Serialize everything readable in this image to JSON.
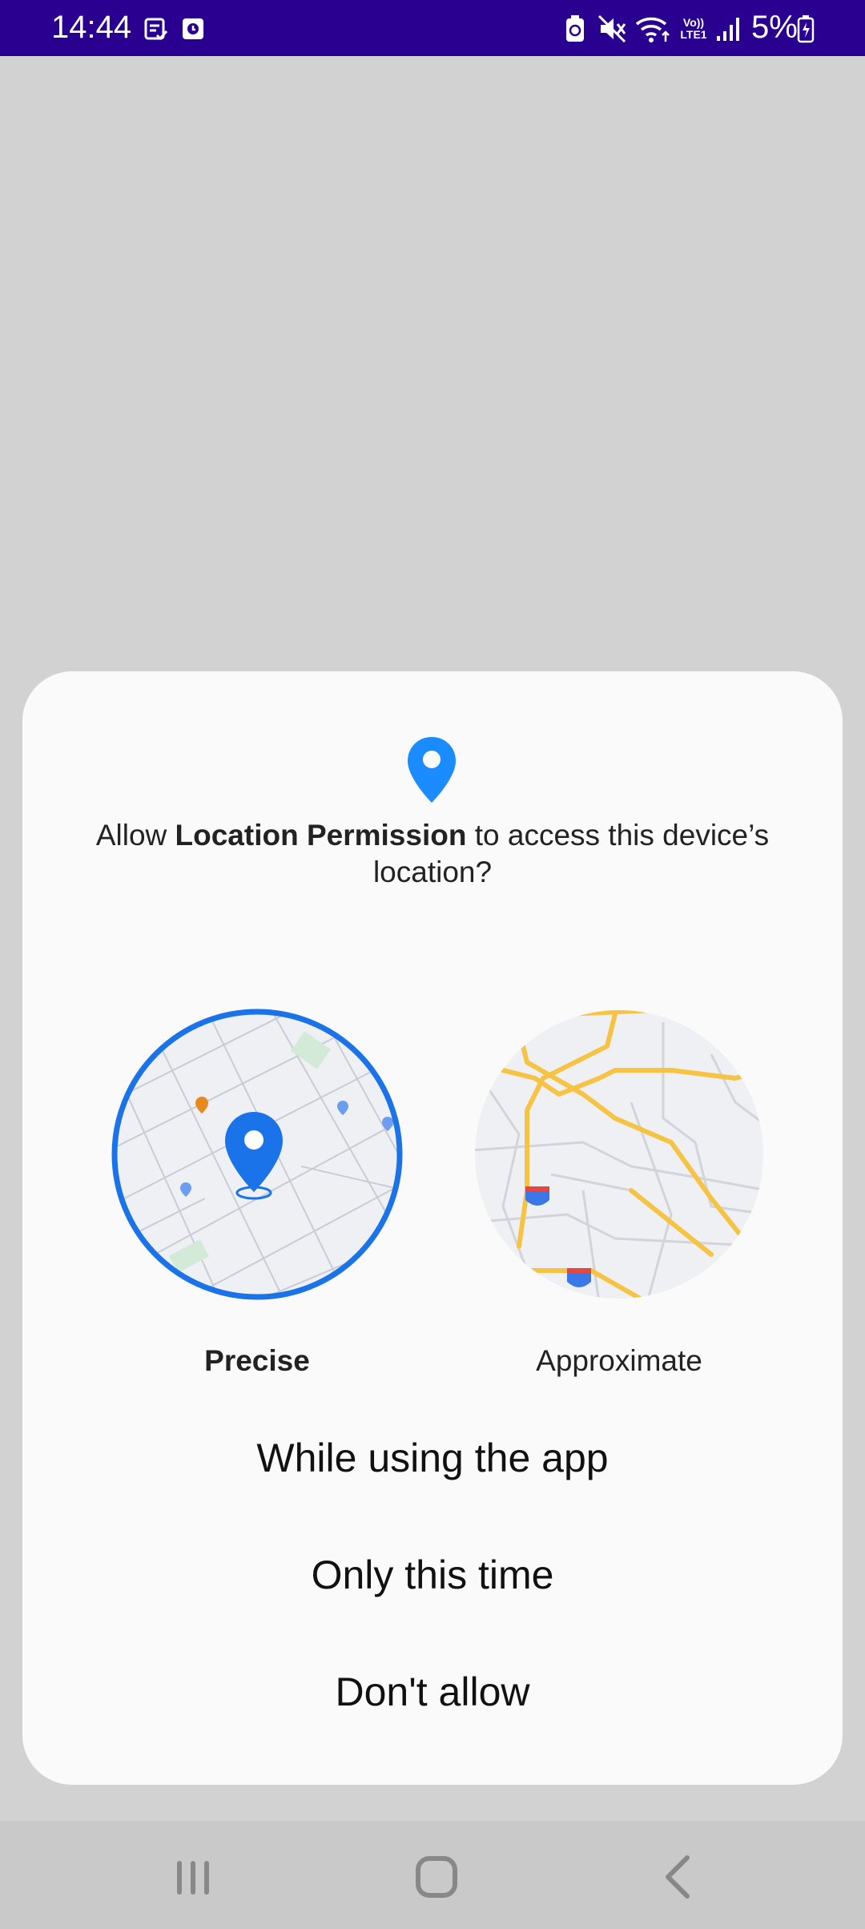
{
  "status_bar": {
    "time": "14:44",
    "battery_percent": "5%",
    "signal_label": "Vo)) LTE1",
    "left_icons": [
      "notification-check-icon",
      "clock-notification-icon"
    ],
    "right_icons": [
      "battery-saver-icon",
      "mute-icon",
      "wifi-icon",
      "volte-icon",
      "signal-icon",
      "battery-charging-icon"
    ]
  },
  "dialog": {
    "prompt_prefix": "Allow ",
    "app_name": "Location Permission",
    "prompt_suffix": " to access this device’s location?",
    "options": {
      "precise": {
        "label": "Precise",
        "selected": true
      },
      "approximate": {
        "label": "Approximate",
        "selected": false
      }
    },
    "buttons": {
      "while_using": "While using the app",
      "only_this_time": "Only this time",
      "dont_allow": "Don't allow"
    }
  },
  "colors": {
    "status_bar": "#2a0090",
    "accent_blue": "#1a73e8",
    "pin_blue": "#1a8cff",
    "road_yellow": "#f6c343"
  },
  "nav_bar": {
    "icons": [
      "recent-apps-icon",
      "home-icon",
      "back-icon"
    ]
  }
}
